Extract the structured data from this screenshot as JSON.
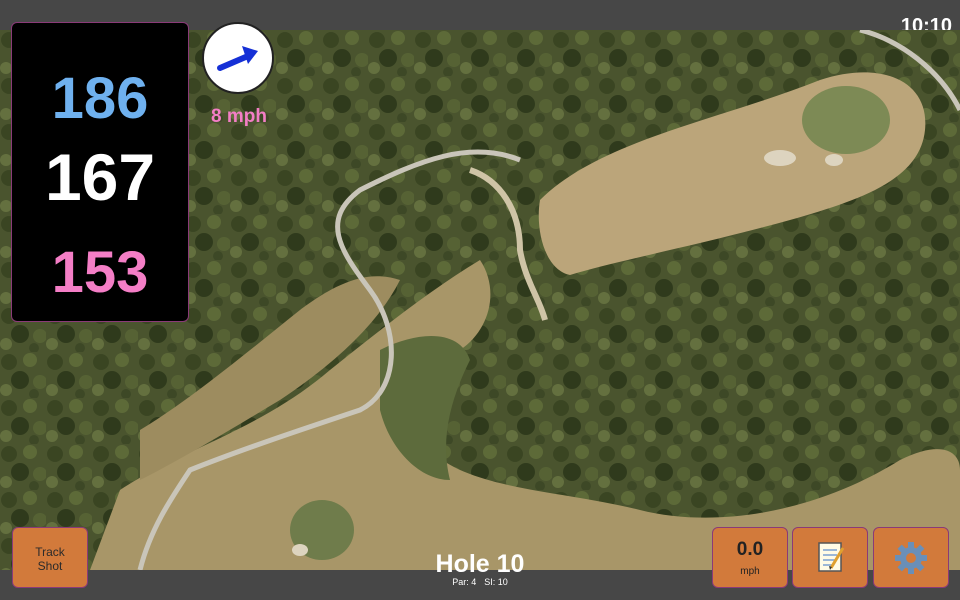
{
  "status": {
    "time": "10:10"
  },
  "yardages": {
    "back": "186",
    "middle": "167",
    "front": "153"
  },
  "wind": {
    "speed_label": "8 mph",
    "direction_icon": "arrow-icon"
  },
  "hole": {
    "title": "Hole 10",
    "par": "Par: 4",
    "stroke_index": "SI: 10"
  },
  "buttons": {
    "track_shot": "Track\nShot",
    "speed_value": "0.0",
    "speed_unit": "mph",
    "notes_icon": "notepad-icon",
    "settings_icon": "gear-icon"
  },
  "colors": {
    "back_yardage": "#6fb1ef",
    "middle_yardage": "#ffffff",
    "front_yardage": "#f47ec6",
    "button_bg": "#d27a3b",
    "wind_arrow": "#1530d6"
  }
}
